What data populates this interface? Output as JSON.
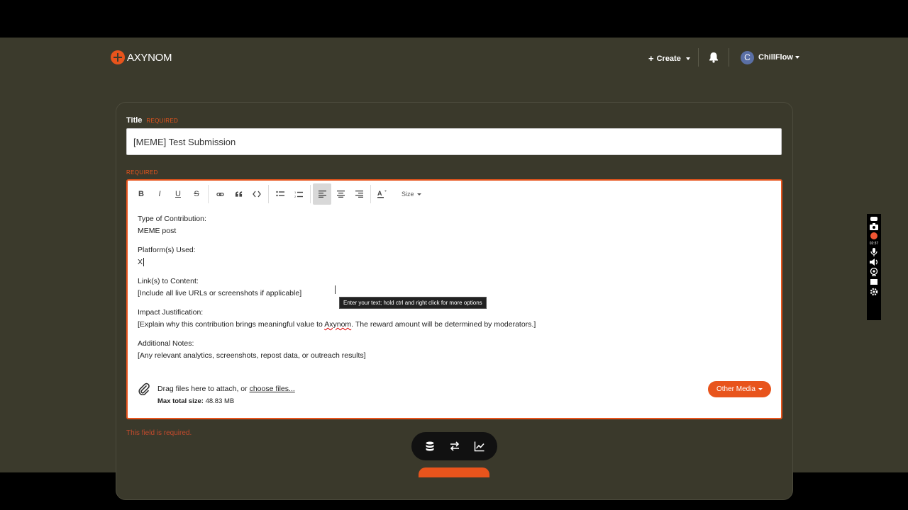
{
  "brand": {
    "name": "AXYNOM",
    "accent": "#e8541c"
  },
  "nav": {
    "create_label": "Create",
    "username": "ChillFlow",
    "avatar_letter": "C"
  },
  "form": {
    "title_label": "Title",
    "required_tag": "REQUIRED",
    "title_value": "[MEME] Test Submission",
    "body_required_tag": "REQUIRED",
    "toolbar": {
      "bold": "B",
      "italic": "I",
      "underline": "U",
      "strike": "S",
      "size_label": "Size"
    },
    "body": {
      "line1": "Type of Contribution:",
      "line2": "MEME post",
      "line3": "Platform(s) Used:",
      "line4": "X",
      "line5": "Link(s) to Content:",
      "line6": "[Include all live URLs or screenshots if applicable]",
      "line7": "Impact Justification:",
      "line8a": "[Explain why this contribution brings meaningful value to ",
      "line8b": "Axynom",
      "line8c": ". The reward amount will be determined by moderators.]",
      "line9": "Additional Notes:",
      "line10": "[Any relevant analytics, screenshots, repost data, or outreach results]"
    },
    "tooltip": "Enter your text; hold ctrl and right click for more options",
    "attach": {
      "drag_text": "Drag files here to attach, or ",
      "choose_link": "choose files...",
      "max_label": "Max total size:",
      "max_value": " 48.83 MB",
      "other_media": "Other Media"
    },
    "error": "This field is required."
  },
  "recorder": {
    "time": "02:37"
  }
}
